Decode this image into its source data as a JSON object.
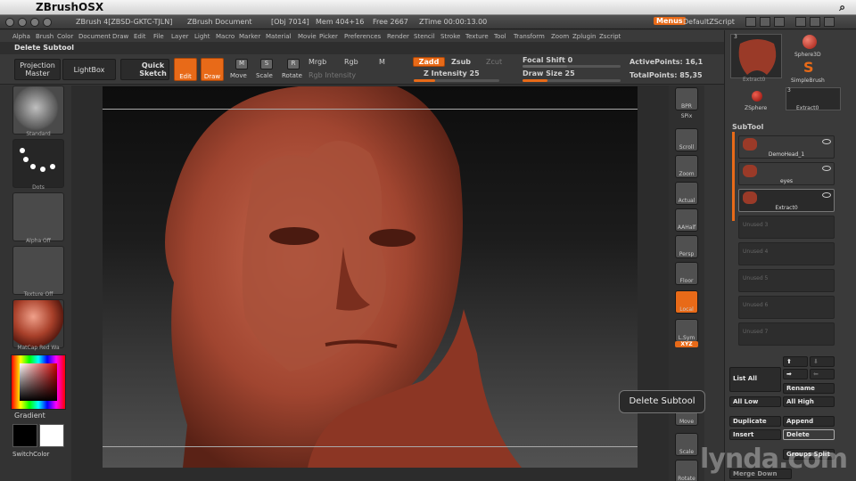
{
  "mac": {
    "apple": "",
    "app": "ZBrushOSX",
    "search": "⌕"
  },
  "window": {
    "zbrush_version": "ZBrush 4[ZBSD-GKTC-TJLN]",
    "doc": "ZBrush Document",
    "obj": "[Obj 7014]",
    "mem": "Mem 404+16",
    "free": "Free 2667",
    "ztime": "ZTime 00:00:13.00",
    "menus": "Menus",
    "script": "DefaultZScript"
  },
  "menu": [
    "Alpha",
    "Brush",
    "Color",
    "Document",
    "Draw",
    "Edit",
    "File",
    "Layer",
    "Light",
    "Macro",
    "Marker",
    "Material",
    "Movie",
    "Picker",
    "Preferences",
    "Render",
    "Stencil",
    "Stroke",
    "Texture",
    "Tool",
    "Transform",
    "Zoom",
    "Zplugin",
    "Zscript"
  ],
  "status": "Delete Subtool",
  "toolbar": {
    "projection": "Projection\nMaster",
    "lightbox": "LightBox",
    "quick_sketch": "Quick\nSketch",
    "edit": "Edit",
    "draw": "Draw",
    "move": "Move",
    "scale": "Scale",
    "rotate": "Rotate",
    "mrgb": "Mrgb",
    "rgb": "Rgb",
    "m": "M",
    "zadd": "Zadd",
    "zsub": "Zsub",
    "zcut": "Zcut",
    "rgb_intensity": "Rgb Intensity",
    "z_intensity": "Z Intensity 25",
    "focal_shift": "Focal Shift 0",
    "draw_size": "Draw Size 25",
    "active_points": "ActivePoints: 16,1",
    "total_points": "TotalPoints: 85,35",
    "z_intensity_level": 0.25,
    "draw_size_level": 0.25
  },
  "left": {
    "standard": "Standard",
    "dots": "Dots",
    "alpha_off": "Alpha Off",
    "texture_off": "Texture Off",
    "matcap": "MatCap Red Wa",
    "gradient": "Gradient",
    "switchcolor": "SwitchColor"
  },
  "rightstrip": {
    "bpr": "BPR",
    "spix": "SPix",
    "scroll": "Scroll",
    "zoom": "Zoom",
    "actual": "Actual",
    "aahalf": "AAHalf",
    "persp": "Persp",
    "floor": "Floor",
    "local": "Local",
    "lsym": "L.Sym",
    "xyz": "XYZ",
    "move": "Move",
    "scale": "Scale",
    "rotate": "Rotate"
  },
  "tools": {
    "extract": "Extract0",
    "sphere3d": "Sphere3D",
    "simplebrush": "SimpleBrush",
    "zsphere": "ZSphere",
    "extract2": "Extract0",
    "count1": "3",
    "count2": "3"
  },
  "subtool": {
    "header": "SubTool",
    "items": [
      {
        "name": "DemoHead_1"
      },
      {
        "name": "eyes"
      },
      {
        "name": "Extract0"
      },
      {
        "name": "Unused 3"
      },
      {
        "name": "Unused 4"
      },
      {
        "name": "Unused 5"
      },
      {
        "name": "Unused 6"
      },
      {
        "name": "Unused 7"
      }
    ],
    "list_all": "List All",
    "rename": "Rename",
    "all_low": "All Low",
    "all_high": "All High",
    "duplicate": "Duplicate",
    "append": "Append",
    "insert": "Insert",
    "delete": "Delete",
    "groups_split": "Groups Split",
    "merge_down": "Merge Down"
  },
  "tooltip": "Delete Subtool",
  "watermark": "lynda.com",
  "colors": {
    "accent": "#e86a18",
    "skin": "#b0503c",
    "panel": "#3a3a3a"
  }
}
